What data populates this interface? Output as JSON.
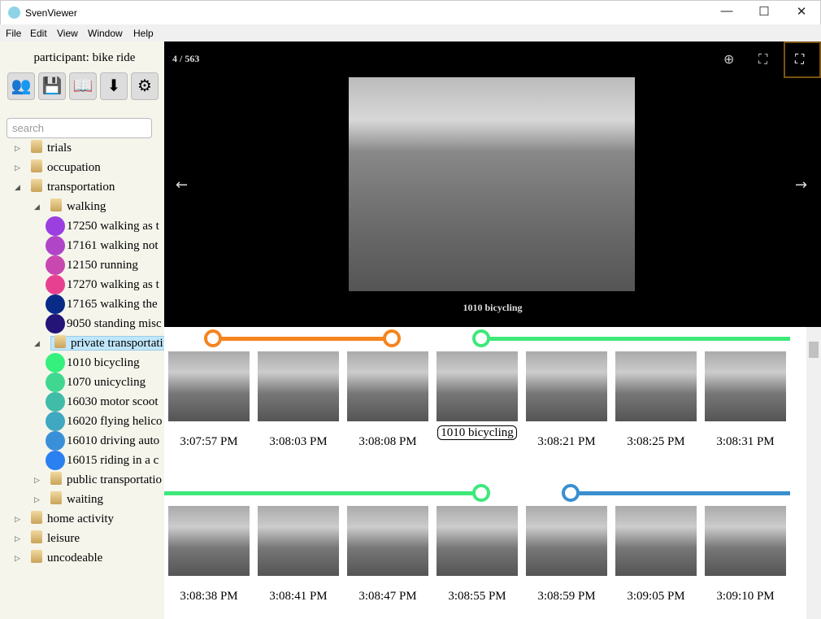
{
  "window": {
    "title": "SvenViewer"
  },
  "menu": [
    "File",
    "Edit",
    "View",
    "Window",
    "Help"
  ],
  "sidebar": {
    "participant": "participant: bike ride",
    "toolbar": [
      "users-icon",
      "save-icon",
      "book-icon",
      "download-icon",
      "gear-icon"
    ],
    "search_placeholder": "search",
    "tree": [
      {
        "label": "trials",
        "level": 0,
        "type": "folder"
      },
      {
        "label": "occupation",
        "level": 0,
        "type": "folder"
      },
      {
        "label": "transportation",
        "level": 0,
        "type": "folder",
        "expanded": true
      },
      {
        "label": "walking",
        "level": 1,
        "type": "folder",
        "expanded": true
      },
      {
        "label": "17250 walking as t",
        "level": 2,
        "color": "#9b3fe0"
      },
      {
        "label": "17161 walking not",
        "level": 2,
        "color": "#b045c8"
      },
      {
        "label": "12150 running",
        "level": 2,
        "color": "#c848b0"
      },
      {
        "label": "17270 walking as t",
        "level": 2,
        "color": "#e84090"
      },
      {
        "label": "17165 walking the",
        "level": 2,
        "color": "#0a2a88"
      },
      {
        "label": "9050 standing misc",
        "level": 2,
        "color": "#241478"
      },
      {
        "label": "private transportati",
        "level": 1,
        "type": "folder",
        "expanded": true,
        "selected": true
      },
      {
        "label": "1010 bicycling",
        "level": 2,
        "color": "#35f07c"
      },
      {
        "label": "1070 unicycling",
        "level": 2,
        "color": "#40d890"
      },
      {
        "label": "16030 motor scoot",
        "level": 2,
        "color": "#40bca8"
      },
      {
        "label": "16020 flying helico",
        "level": 2,
        "color": "#40a8c0"
      },
      {
        "label": "16010 driving auto",
        "level": 2,
        "color": "#3a90d8"
      },
      {
        "label": "16015 riding in a c",
        "level": 2,
        "color": "#2a80f0"
      },
      {
        "label": "public transportatio",
        "level": 1,
        "type": "folder"
      },
      {
        "label": "waiting",
        "level": 1,
        "type": "folder"
      },
      {
        "label": "home activity",
        "level": 0,
        "type": "folder"
      },
      {
        "label": "leisure",
        "level": 0,
        "type": "folder"
      },
      {
        "label": "uncodeable",
        "level": 0,
        "type": "folder"
      }
    ]
  },
  "viewer": {
    "counter": "4 / 563",
    "caption": "1010 bicycling",
    "icons": [
      "zoom-in-icon",
      "fullscreen-icon",
      "fullscreen-active-icon"
    ]
  },
  "gallery": {
    "rows": [
      {
        "times": [
          "3:07:57 PM",
          "3:08:03 PM",
          "3:08:08 PM",
          "1010 bicycling",
          "3:08:21 PM",
          "3:08:25 PM",
          "3:08:31 PM"
        ],
        "segments": [
          {
            "color": "#f5841f",
            "from": 0,
            "to": 2
          },
          {
            "color": "#3ee87a",
            "from": 3,
            "to": null
          }
        ]
      },
      {
        "times": [
          "3:08:38 PM",
          "3:08:41 PM",
          "3:08:47 PM",
          "3:08:55 PM",
          "3:08:59 PM",
          "3:09:05 PM",
          "3:09:10 PM"
        ],
        "segments": [
          {
            "color": "#3ee87a",
            "from": null,
            "to": 3
          },
          {
            "color": "#3a8fd0",
            "from": 4,
            "to": null
          }
        ]
      }
    ]
  }
}
